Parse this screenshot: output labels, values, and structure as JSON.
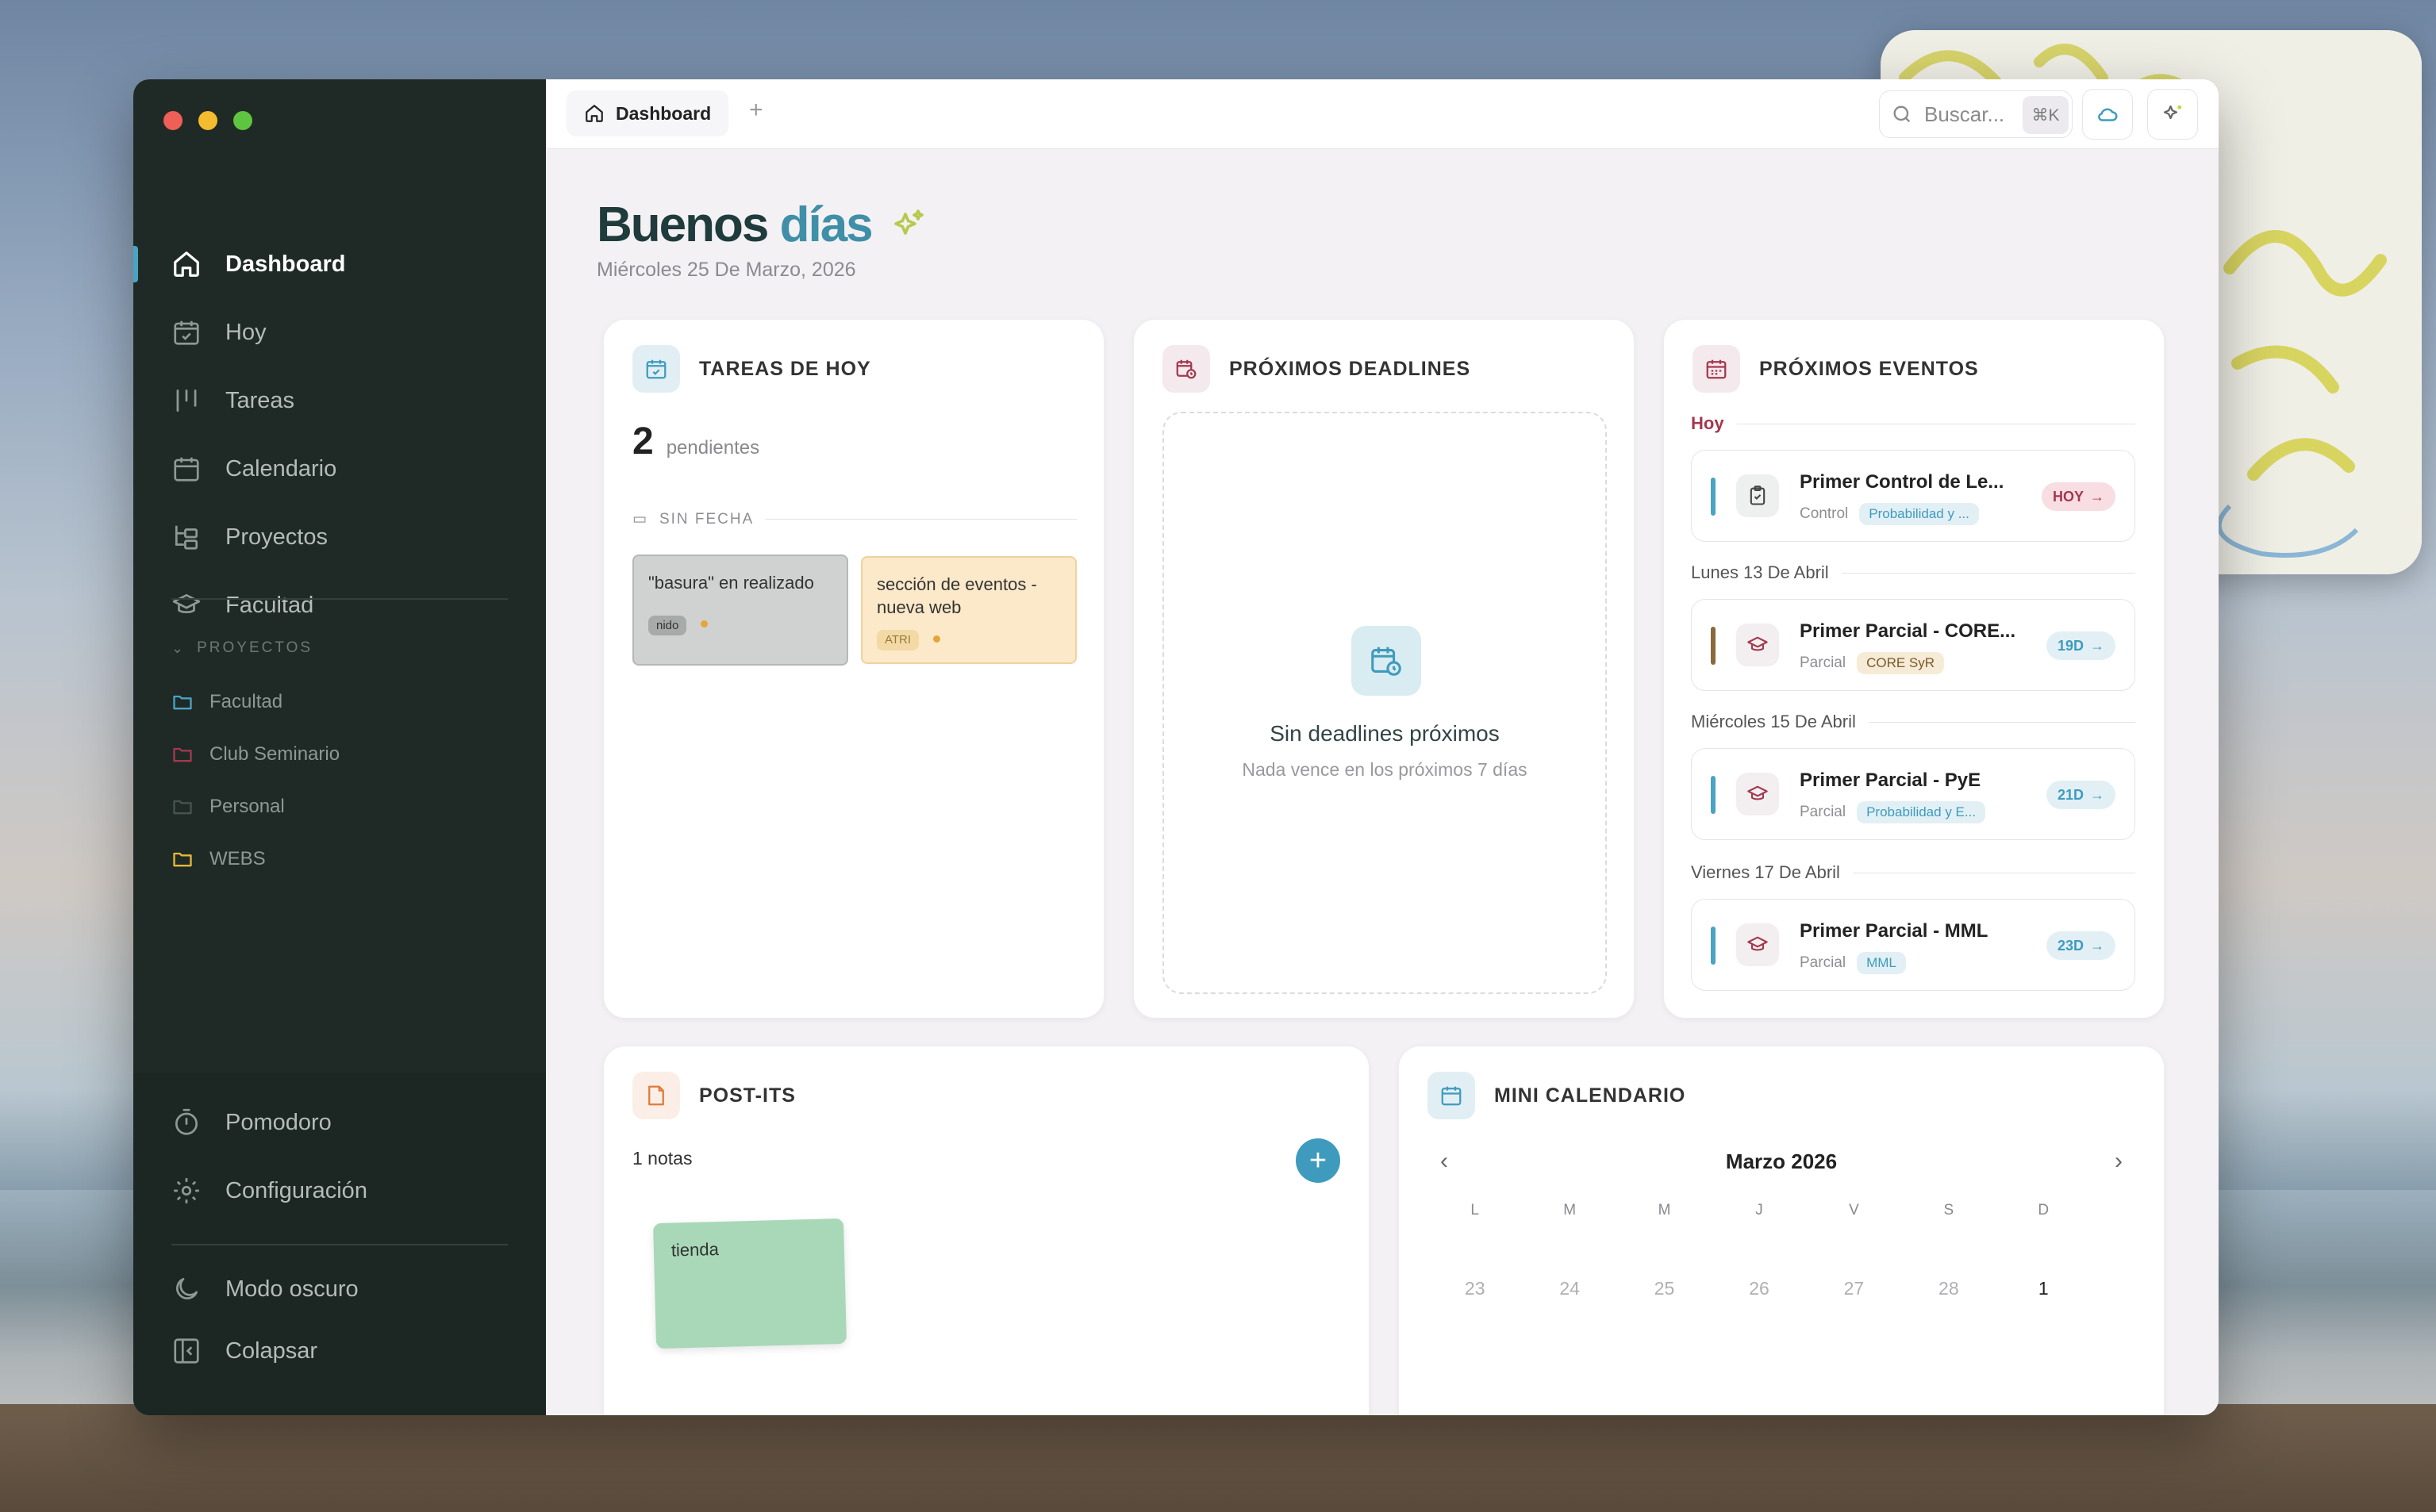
{
  "sidebar": {
    "nav": [
      {
        "label": "Dashboard",
        "icon": "home-icon"
      },
      {
        "label": "Hoy",
        "icon": "calendar-check-icon"
      },
      {
        "label": "Tareas",
        "icon": "kanban-icon"
      },
      {
        "label": "Calendario",
        "icon": "calendar-icon"
      },
      {
        "label": "Proyectos",
        "icon": "folder-tree-icon"
      },
      {
        "label": "Facultad",
        "icon": "graduation-cap-icon"
      }
    ],
    "projects_heading": "PROYECTOS",
    "projects": [
      {
        "label": "Facultad",
        "color": "#4aa3c3"
      },
      {
        "label": "Club Seminario",
        "color": "#a3384e"
      },
      {
        "label": "Personal",
        "color": "#3e4a45"
      },
      {
        "label": "WEBS",
        "color": "#e6b93a"
      }
    ],
    "bottom": {
      "pomodoro": "Pomodoro",
      "settings": "Configuración",
      "dark_mode": "Modo oscuro",
      "collapse": "Colapsar"
    }
  },
  "topbar": {
    "tab_label": "Dashboard",
    "tab_add": "+",
    "search_placeholder": "Buscar...",
    "search_shortcut": "⌘K"
  },
  "header": {
    "greeting_1": "Buenos",
    "greeting_2": "días",
    "date": "Miércoles 25 De Marzo, 2026"
  },
  "tareas": {
    "title": "TAREAS DE HOY",
    "count": "2",
    "count_label": "pendientes",
    "group": "SIN FECHA",
    "items": [
      {
        "text": "\"basura\" en realizado",
        "tag": "nido"
      },
      {
        "text": "sección de eventos - nueva web",
        "tag": "ATRI"
      }
    ]
  },
  "deadlines": {
    "title": "PRÓXIMOS DEADLINES",
    "empty_title": "Sin deadlines próximos",
    "empty_sub": "Nada vence en los próximos 7 días"
  },
  "eventos": {
    "title": "PRÓXIMOS EVENTOS",
    "groups": [
      {
        "label": "Hoy",
        "title": "Primer Control de Le...",
        "type": "Control",
        "tag": "Probabilidad y ...",
        "badge": "HOY",
        "bar": "#4aa3c3"
      },
      {
        "label": "Lunes 13 De Abril",
        "title": "Primer Parcial - CORE...",
        "type": "Parcial",
        "tag": "CORE SyR",
        "badge": "19D",
        "bar": "#8a6a3a"
      },
      {
        "label": "Miércoles 15 De Abril",
        "title": "Primer Parcial - PyE",
        "type": "Parcial",
        "tag": "Probabilidad y E...",
        "badge": "21D",
        "bar": "#4aa3c3"
      },
      {
        "label": "Viernes 17 De Abril",
        "title": "Primer Parcial - MML",
        "type": "Parcial",
        "tag": "MML",
        "badge": "23D",
        "bar": "#4aa3c3"
      }
    ]
  },
  "postits": {
    "title": "POST-ITS",
    "count": "1 notas",
    "add": "+",
    "notes": [
      {
        "text": "tienda"
      }
    ]
  },
  "calendar": {
    "title": "MINI CALENDARIO",
    "month": "Marzo 2026",
    "prev": "‹",
    "next": "›",
    "weekdays": [
      "L",
      "M",
      "M",
      "J",
      "V",
      "S",
      "D"
    ],
    "first_week": [
      "23",
      "24",
      "25",
      "26",
      "27",
      "28",
      "1"
    ]
  }
}
